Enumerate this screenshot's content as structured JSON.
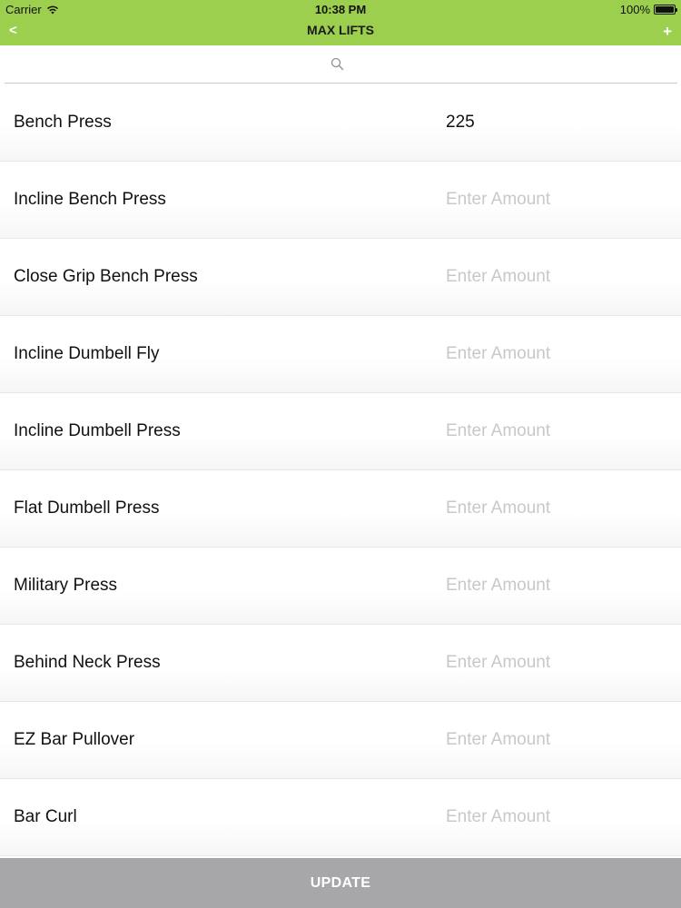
{
  "status_bar": {
    "carrier": "Carrier",
    "time": "10:38 PM",
    "battery": "100%",
    "battery_level_percent": 100
  },
  "nav": {
    "back_label": "<",
    "title": "MAX LIFTS",
    "add_label": "+"
  },
  "search": {
    "placeholder": "",
    "value": ""
  },
  "placeholder": "Enter Amount",
  "lifts": [
    {
      "name": "Bench Press",
      "value": "225"
    },
    {
      "name": "Incline Bench Press",
      "value": ""
    },
    {
      "name": "Close Grip Bench Press",
      "value": ""
    },
    {
      "name": "Incline Dumbell Fly",
      "value": ""
    },
    {
      "name": "Incline Dumbell Press",
      "value": ""
    },
    {
      "name": "Flat Dumbell Press",
      "value": ""
    },
    {
      "name": "Military Press",
      "value": ""
    },
    {
      "name": "Behind Neck Press",
      "value": ""
    },
    {
      "name": "EZ Bar Pullover",
      "value": ""
    },
    {
      "name": "Bar Curl",
      "value": ""
    }
  ],
  "update_label": "UPDATE",
  "colors": {
    "accent": "#9dcf4f",
    "update_button": "#a7a7a9",
    "placeholder_text": "#c8c8cc"
  },
  "icons": {
    "wifi": "wifi-icon",
    "battery": "battery-icon",
    "search": "search-icon"
  }
}
